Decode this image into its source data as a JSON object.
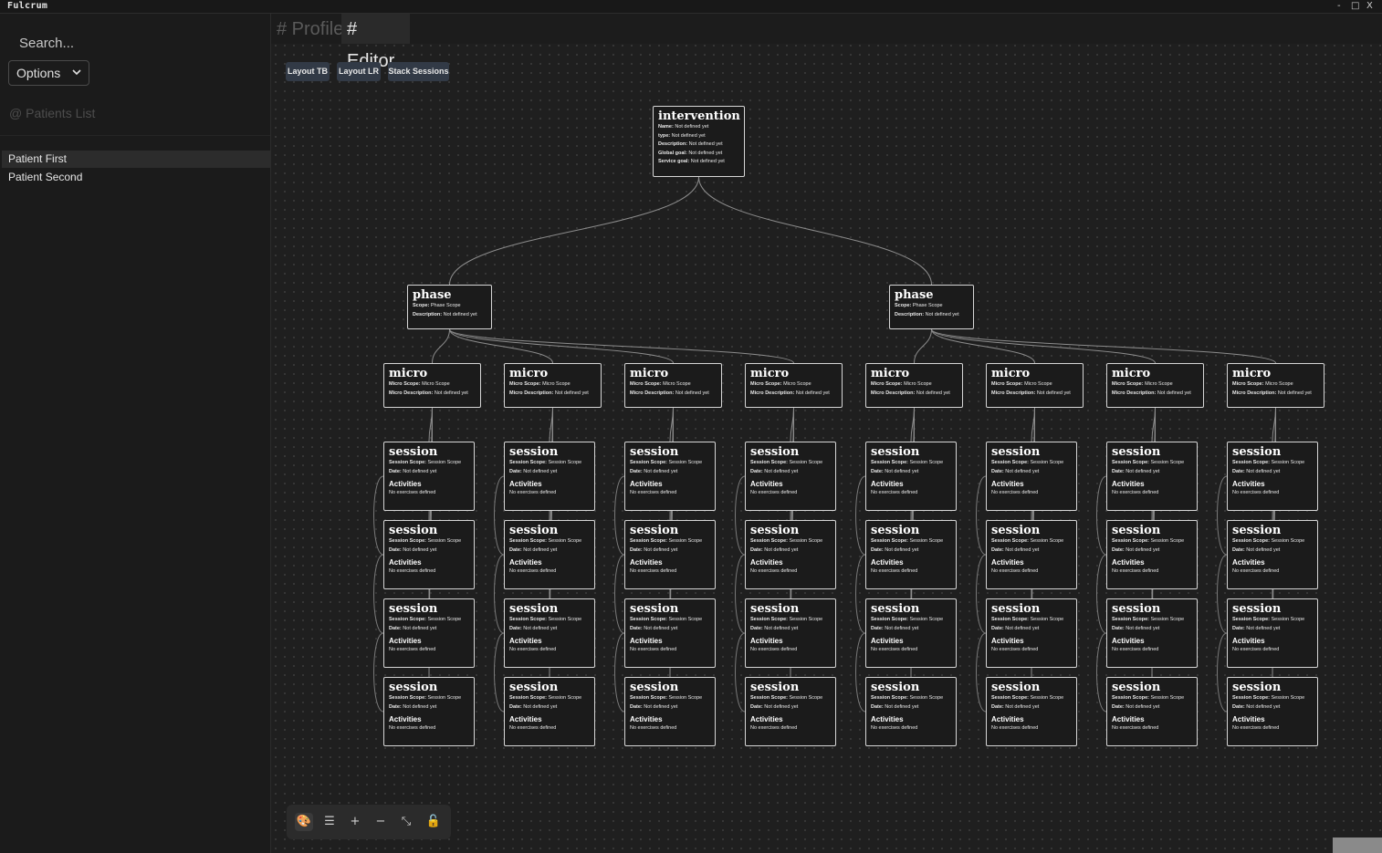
{
  "app": {
    "title": "Fulcrum",
    "minimize": "-",
    "maximize": "□",
    "close": "X"
  },
  "sidebar": {
    "search_placeholder": "Search...",
    "options_label": "Options",
    "patients_title": "@ Patients List",
    "patients": [
      {
        "name": "Patient First",
        "selected": true
      },
      {
        "name": "Patient Second",
        "selected": false
      }
    ]
  },
  "tabs": [
    {
      "label": "# Profile",
      "active": false
    },
    {
      "label": "# Editor",
      "active": true
    }
  ],
  "toolbar": {
    "layout_tb": "Layout TB",
    "layout_lr": "Layout LR",
    "stack_sessions": "Stack Sessions"
  },
  "graph": {
    "intervention": {
      "title": "intervention",
      "fields": [
        {
          "k": "Name:",
          "v": "Not defined yet"
        },
        {
          "k": "type:",
          "v": "Not defined yet"
        },
        {
          "k": "Description:",
          "v": "Not defined yet"
        },
        {
          "k": "Global goal:",
          "v": "Not defined yet"
        },
        {
          "k": "Service goal:",
          "v": "Not defined yet"
        }
      ]
    },
    "phase": {
      "title": "phase",
      "fields": [
        {
          "k": "Scope:",
          "v": "Phase Scope"
        },
        {
          "k": "Description:",
          "v": "Not defined yet"
        }
      ]
    },
    "micro": {
      "title": "micro",
      "fields": [
        {
          "k": "Micro Scope:",
          "v": "Micro Scope"
        },
        {
          "k": "Micro Description:",
          "v": "Not defined yet"
        }
      ]
    },
    "session": {
      "title": "session",
      "fields": [
        {
          "k": "Session Scope:",
          "v": "Session Scope"
        },
        {
          "k": "Date:",
          "v": "Not defined yet"
        }
      ],
      "activities": "Activities",
      "empty": "No exercises defined"
    },
    "counts": {
      "phases": 2,
      "micros_per_phase": 4,
      "sessions_per_micro": 4
    }
  },
  "controls": [
    {
      "name": "palette-icon",
      "glyph": "🎨"
    },
    {
      "name": "menu-icon",
      "glyph": "☰"
    },
    {
      "name": "zoom-in-icon",
      "glyph": "+"
    },
    {
      "name": "zoom-out-icon",
      "glyph": "−"
    },
    {
      "name": "fit-view-icon",
      "glyph": "⤡"
    },
    {
      "name": "lock-icon",
      "glyph": "🔓"
    }
  ]
}
